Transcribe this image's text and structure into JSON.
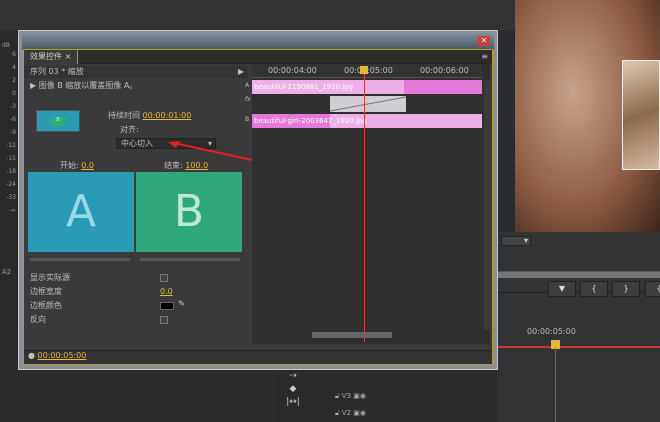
{
  "dialog": {
    "tab": "效果控件",
    "tab_close": "×",
    "menu": "≡"
  },
  "header": {
    "sequence": "序列 03 * 缩放",
    "play": "▶",
    "effect_desc": "图像 B 缩放以覆盖图像 A。"
  },
  "thumb": {
    "label": "B"
  },
  "duration": {
    "label": "持续时间",
    "value": "00:00:01:00"
  },
  "align": {
    "label": "对齐:",
    "value": "中心切入"
  },
  "start": {
    "label": "开始:",
    "value": "0.0"
  },
  "end": {
    "label": "结束:",
    "value": "100.0"
  },
  "preview": {
    "a": "A",
    "b": "B"
  },
  "props": {
    "show_source": "显示实际源",
    "border_width": "边框宽度",
    "border_width_value": "0.0",
    "border_color": "边框颜色",
    "reverse": "反向"
  },
  "footer": {
    "time": "00:00:05:00"
  },
  "timeline": {
    "ticks": [
      "00:00:04:00",
      "00:00:05:00",
      "00:00:06:00"
    ],
    "track_a": "A",
    "track_fx": "fx",
    "track_b": "B",
    "clip_a": "beautiful-2150881_1920.jpg",
    "clip_b": "beautiful-girl-2003647_1920.jpg"
  },
  "meter": {
    "unit": "dB",
    "levels": [
      "6",
      "4",
      "2",
      "0",
      "-3",
      "-6",
      "-9",
      "-12",
      "-15",
      "-18",
      "-24",
      "-33",
      "-∞"
    ],
    "channel": "A2"
  },
  "seq": {
    "time": "00:00:05:00",
    "tracks": [
      {
        "name": "V3"
      },
      {
        "name": "V2"
      }
    ]
  },
  "colors": {
    "accent": "#e8b830",
    "playhead": "#e03a3a",
    "clip": "#e88ae0"
  }
}
